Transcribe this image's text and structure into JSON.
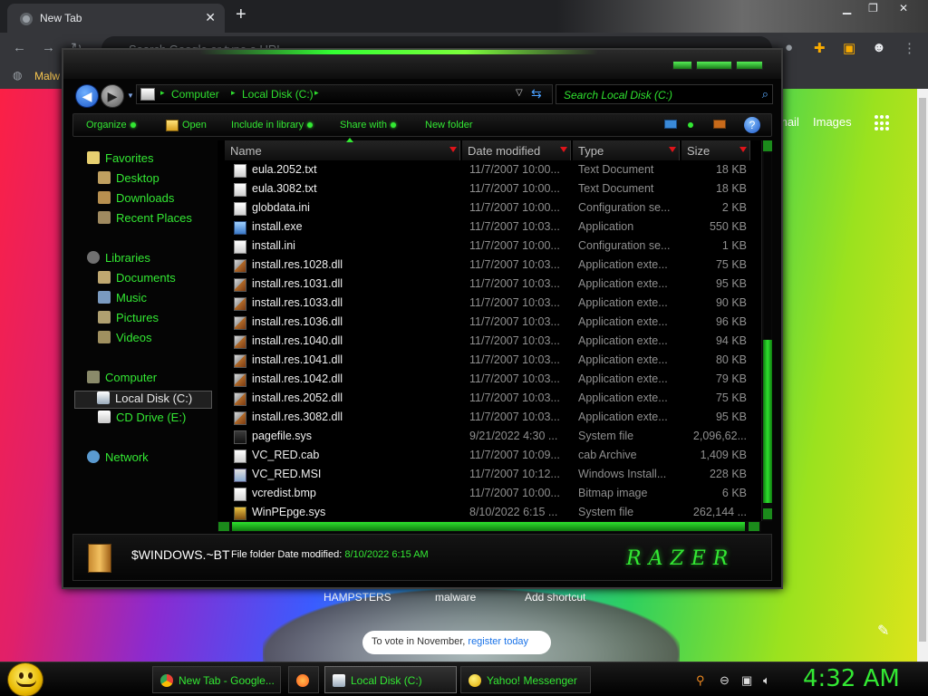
{
  "chrome": {
    "tab_title": "New Tab",
    "omnibox_placeholder": "Search Google or type a URL",
    "bookmark_label": "Malw"
  },
  "ntp": {
    "links": [
      "mail",
      "Images"
    ],
    "shortcuts": [
      "HAMPSTERS",
      "malware",
      "Add shortcut"
    ],
    "vote_text": "To vote in November,",
    "vote_link": "register today"
  },
  "explorer": {
    "address": {
      "crumbs": [
        "Computer",
        "Local Disk (C:)"
      ]
    },
    "search_placeholder": "Search Local Disk (C:)",
    "commands": [
      "Organize",
      "Open",
      "Include in library",
      "Share with",
      "New folder"
    ],
    "nav": {
      "favorites": "Favorites",
      "desktop": "Desktop",
      "downloads": "Downloads",
      "recent": "Recent Places",
      "libraries": "Libraries",
      "documents": "Documents",
      "music": "Music",
      "pictures": "Pictures",
      "videos": "Videos",
      "computer": "Computer",
      "local_disk": "Local Disk (C:)",
      "cd_drive": "CD Drive (E:)",
      "network": "Network"
    },
    "columns": [
      "Name",
      "Date modified",
      "Type",
      "Size"
    ],
    "files": [
      {
        "icon": "text-file-icon",
        "name": "eula.2052.txt",
        "date": "11/7/2007 10:00...",
        "type": "Text Document",
        "size": "18 KB"
      },
      {
        "icon": "text-file-icon",
        "name": "eula.3082.txt",
        "date": "11/7/2007 10:00...",
        "type": "Text Document",
        "size": "18 KB"
      },
      {
        "icon": "text-file-icon",
        "name": "globdata.ini",
        "date": "11/7/2007 10:00...",
        "type": "Configuration se...",
        "size": "2 KB"
      },
      {
        "icon": "exe-file-icon",
        "name": "install.exe",
        "date": "11/7/2007 10:03...",
        "type": "Application",
        "size": "550 KB"
      },
      {
        "icon": "text-file-icon",
        "name": "install.ini",
        "date": "11/7/2007 10:00...",
        "type": "Configuration se...",
        "size": "1 KB"
      },
      {
        "icon": "dll-file-icon",
        "name": "install.res.1028.dll",
        "date": "11/7/2007 10:03...",
        "type": "Application exte...",
        "size": "75 KB"
      },
      {
        "icon": "dll-file-icon",
        "name": "install.res.1031.dll",
        "date": "11/7/2007 10:03...",
        "type": "Application exte...",
        "size": "95 KB"
      },
      {
        "icon": "dll-file-icon",
        "name": "install.res.1033.dll",
        "date": "11/7/2007 10:03...",
        "type": "Application exte...",
        "size": "90 KB"
      },
      {
        "icon": "dll-file-icon",
        "name": "install.res.1036.dll",
        "date": "11/7/2007 10:03...",
        "type": "Application exte...",
        "size": "96 KB"
      },
      {
        "icon": "dll-file-icon",
        "name": "install.res.1040.dll",
        "date": "11/7/2007 10:03...",
        "type": "Application exte...",
        "size": "94 KB"
      },
      {
        "icon": "dll-file-icon",
        "name": "install.res.1041.dll",
        "date": "11/7/2007 10:03...",
        "type": "Application exte...",
        "size": "80 KB"
      },
      {
        "icon": "dll-file-icon",
        "name": "install.res.1042.dll",
        "date": "11/7/2007 10:03...",
        "type": "Application exte...",
        "size": "79 KB"
      },
      {
        "icon": "dll-file-icon",
        "name": "install.res.2052.dll",
        "date": "11/7/2007 10:03...",
        "type": "Application exte...",
        "size": "75 KB"
      },
      {
        "icon": "dll-file-icon",
        "name": "install.res.3082.dll",
        "date": "11/7/2007 10:03...",
        "type": "Application exte...",
        "size": "95 KB"
      },
      {
        "icon": "system-file-icon",
        "name": "pagefile.sys",
        "date": "9/21/2022 4:30 ...",
        "type": "System file",
        "size": "2,096,62..."
      },
      {
        "icon": "cab-file-icon",
        "name": "VC_RED.cab",
        "date": "11/7/2007 10:09...",
        "type": "cab Archive",
        "size": "1,409 KB"
      },
      {
        "icon": "msi-file-icon",
        "name": "VC_RED.MSI",
        "date": "11/7/2007 10:12...",
        "type": "Windows Install...",
        "size": "228 KB"
      },
      {
        "icon": "bmp-file-icon",
        "name": "vcredist.bmp",
        "date": "11/7/2007 10:00...",
        "type": "Bitmap image",
        "size": "6 KB"
      },
      {
        "icon": "locked-system-file-icon",
        "name": "WinPEpge.sys",
        "date": "8/10/2022 6:15 ...",
        "type": "System file",
        "size": "262,144 ..."
      }
    ],
    "details": {
      "name": "$WINDOWS.~BT",
      "kind": "File folder",
      "date_label": "Date modified:",
      "date_value": "8/10/2022 6:15 AM",
      "logo_text": "RAZER"
    }
  },
  "taskbar": {
    "tasks": [
      "New Tab - Google...",
      "Local Disk (C:)",
      "Yahoo! Messenger"
    ],
    "clock": "4:32 AM"
  },
  "colors": {
    "accent_green": "#33e833",
    "sort_arrow_red": "#e0141a"
  }
}
